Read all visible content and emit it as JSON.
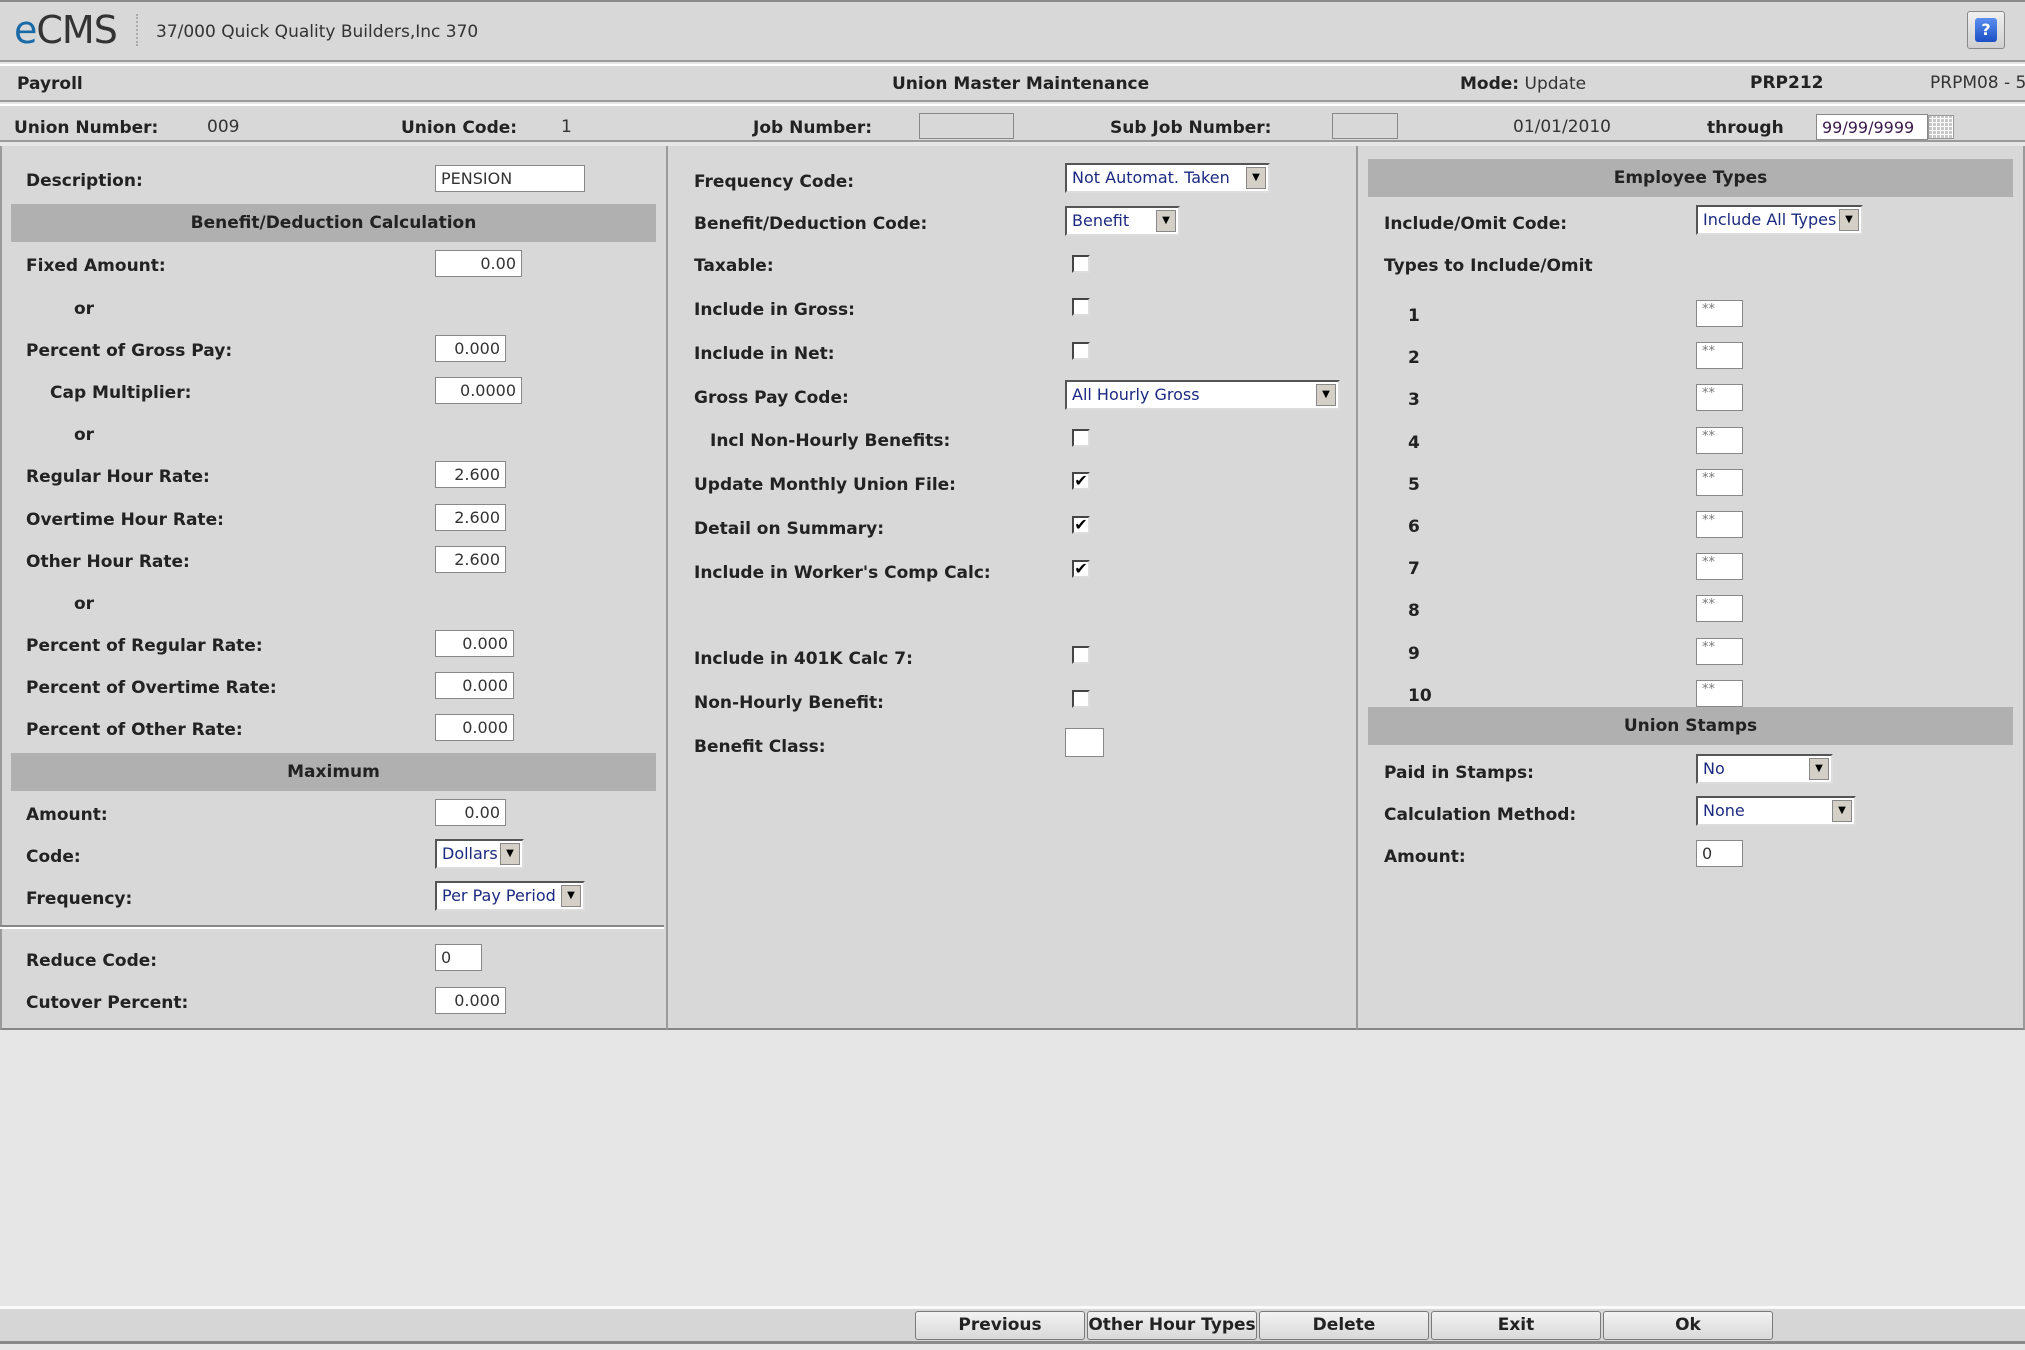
{
  "app": {
    "logo_e": "e",
    "logo_rest": "CMS",
    "company": "37/000  Quick Quality Builders,Inc 370",
    "help_label": "?"
  },
  "title_bar": {
    "module": "Payroll",
    "screen_title": "Union Master Maintenance",
    "mode_label": "Mode:",
    "mode_value": "Update",
    "program": "PRP212",
    "screen_id": "PRPM08 - 5"
  },
  "key_bar": {
    "union_number_label": "Union Number:",
    "union_number_value": "009",
    "union_code_label": "Union Code:",
    "union_code_value": "1",
    "job_number_label": "Job Number:",
    "job_number_value": "",
    "sub_job_number_label": "Sub Job Number:",
    "sub_job_number_value": "",
    "from_date": "01/01/2010",
    "through_label": "through",
    "through_date": "99/99/9999"
  },
  "left_panel": {
    "description_label": "Description:",
    "description_value": "PENSION",
    "calc_header": "Benefit/Deduction Calculation",
    "fixed_amount_label": "Fixed Amount:",
    "fixed_amount_value": "0.00",
    "or_label": "or",
    "percent_gross_label": "Percent of Gross Pay:",
    "percent_gross_value": "0.000",
    "cap_multiplier_label": "Cap Multiplier:",
    "cap_multiplier_value": "0.0000",
    "regular_rate_label": "Regular Hour Rate:",
    "regular_rate_value": "2.600",
    "overtime_rate_label": "Overtime Hour Rate:",
    "overtime_rate_value": "2.600",
    "other_rate_label": "Other Hour Rate:",
    "other_rate_value": "2.600",
    "pct_regular_label": "Percent of Regular Rate:",
    "pct_regular_value": "0.000",
    "pct_overtime_label": "Percent of Overtime Rate:",
    "pct_overtime_value": "0.000",
    "pct_other_label": "Percent of Other Rate:",
    "pct_other_value": "0.000",
    "max_header": "Maximum",
    "max_amount_label": "Amount:",
    "max_amount_value": "0.00",
    "max_code_label": "Code:",
    "max_code_value": "Dollars",
    "max_frequency_label": "Frequency:",
    "max_frequency_value": "Per Pay Period",
    "reduce_code_label": "Reduce Code:",
    "reduce_code_value": "0",
    "cutover_label": "Cutover Percent:",
    "cutover_value": "0.000"
  },
  "middle_panel": {
    "frequency_code_label": "Frequency Code:",
    "frequency_code_value": "Not Automat. Taken",
    "bd_code_label": "Benefit/Deduction Code:",
    "bd_code_value": "Benefit",
    "taxable_label": "Taxable:",
    "taxable_checked": false,
    "include_gross_label": "Include in Gross:",
    "include_gross_checked": false,
    "include_net_label": "Include in Net:",
    "include_net_checked": false,
    "gross_pay_code_label": "Gross Pay Code:",
    "gross_pay_code_value": "All Hourly Gross",
    "incl_non_hourly_label": "Incl Non-Hourly Benefits:",
    "incl_non_hourly_checked": false,
    "update_monthly_label": "Update Monthly Union File:",
    "update_monthly_checked": true,
    "detail_summary_label": "Detail on Summary:",
    "detail_summary_checked": true,
    "workers_comp_label": "Include in Worker's Comp Calc:",
    "workers_comp_checked": true,
    "include_401k_label": "Include in 401K Calc 7:",
    "include_401k_checked": false,
    "non_hourly_benefit_label": "Non-Hourly Benefit:",
    "non_hourly_benefit_checked": false,
    "benefit_class_label": "Benefit Class:",
    "benefit_class_value": "",
    "check_glyph": "✔"
  },
  "right_panel": {
    "emp_types_header": "Employee Types",
    "include_omit_label": "Include/Omit Code:",
    "include_omit_value": "Include All Types",
    "types_label": "Types to Include/Omit",
    "types": [
      {
        "num": "1",
        "value": "**"
      },
      {
        "num": "2",
        "value": "**"
      },
      {
        "num": "3",
        "value": "**"
      },
      {
        "num": "4",
        "value": "**"
      },
      {
        "num": "5",
        "value": "**"
      },
      {
        "num": "6",
        "value": "**"
      },
      {
        "num": "7",
        "value": "**"
      },
      {
        "num": "8",
        "value": "**"
      },
      {
        "num": "9",
        "value": "**"
      },
      {
        "num": "10",
        "value": "**"
      }
    ],
    "stamps_header": "Union Stamps",
    "paid_stamps_label": "Paid in Stamps:",
    "paid_stamps_value": "No",
    "calc_method_label": "Calculation Method:",
    "calc_method_value": "None",
    "stamp_amount_label": "Amount:",
    "stamp_amount_value": "0"
  },
  "buttons": {
    "previous": "Previous",
    "other_hour_types": "Other Hour Types",
    "delete": "Delete",
    "exit": "Exit",
    "ok": "Ok"
  },
  "colors": {
    "logo_accent": "#1a6aa8",
    "select_text": "#1b2a80",
    "section_header_bg": "#b0b0b0",
    "panel_bg": "#d8d8d8",
    "help_button": "#1c4fc4"
  }
}
